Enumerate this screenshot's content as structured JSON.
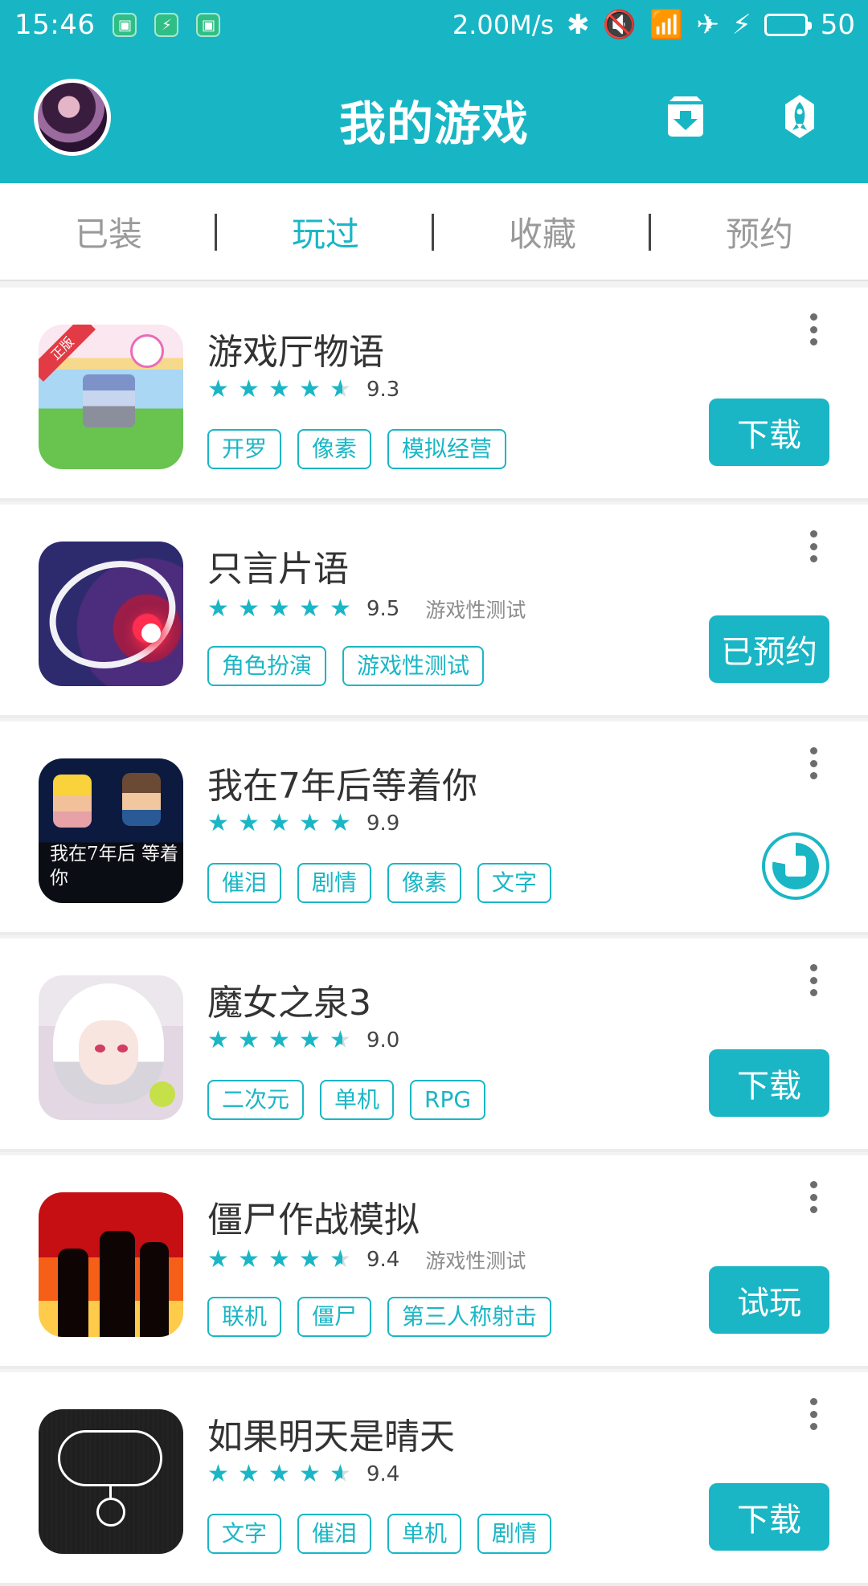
{
  "status_bar": {
    "time": "15:46",
    "speed": "2.00M/s",
    "battery_percent": "50"
  },
  "header": {
    "title": "我的游戏",
    "colors": {
      "primary": "#18b6c4",
      "accent": "#1ab6c5"
    }
  },
  "tabs": [
    {
      "label": "已装"
    },
    {
      "label": "玩过"
    },
    {
      "label": "收藏"
    },
    {
      "label": "预约"
    }
  ],
  "games": [
    {
      "name": "游戏厅物语",
      "rating": "9.3",
      "stars": 4.5,
      "note": "",
      "tags": [
        "开罗",
        "像素",
        "模拟经营"
      ],
      "action": "下载",
      "badge": "正版"
    },
    {
      "name": "只言片语",
      "rating": "9.5",
      "stars": 5,
      "note": "游戏性测试",
      "tags": [
        "角色扮演",
        "游戏性测试"
      ],
      "action": "已预约"
    },
    {
      "name": "我在7年后等着你",
      "rating": "9.9",
      "stars": 5,
      "note": "",
      "tags": [
        "催泪",
        "剧情",
        "像素",
        "文字"
      ],
      "action": "",
      "icon_text": "我在7年后 等着你"
    },
    {
      "name": "魔女之泉3",
      "rating": "9.0",
      "stars": 4.5,
      "note": "",
      "tags": [
        "二次元",
        "单机",
        "RPG"
      ],
      "action": "下载"
    },
    {
      "name": "僵尸作战模拟",
      "rating": "9.4",
      "stars": 4.5,
      "note": "游戏性测试",
      "tags": [
        "联机",
        "僵尸",
        "第三人称射击"
      ],
      "action": "试玩"
    },
    {
      "name": "如果明天是晴天",
      "rating": "9.4",
      "stars": 4.5,
      "note": "",
      "tags": [
        "文字",
        "催泪",
        "单机",
        "剧情"
      ],
      "action": "下载"
    }
  ]
}
